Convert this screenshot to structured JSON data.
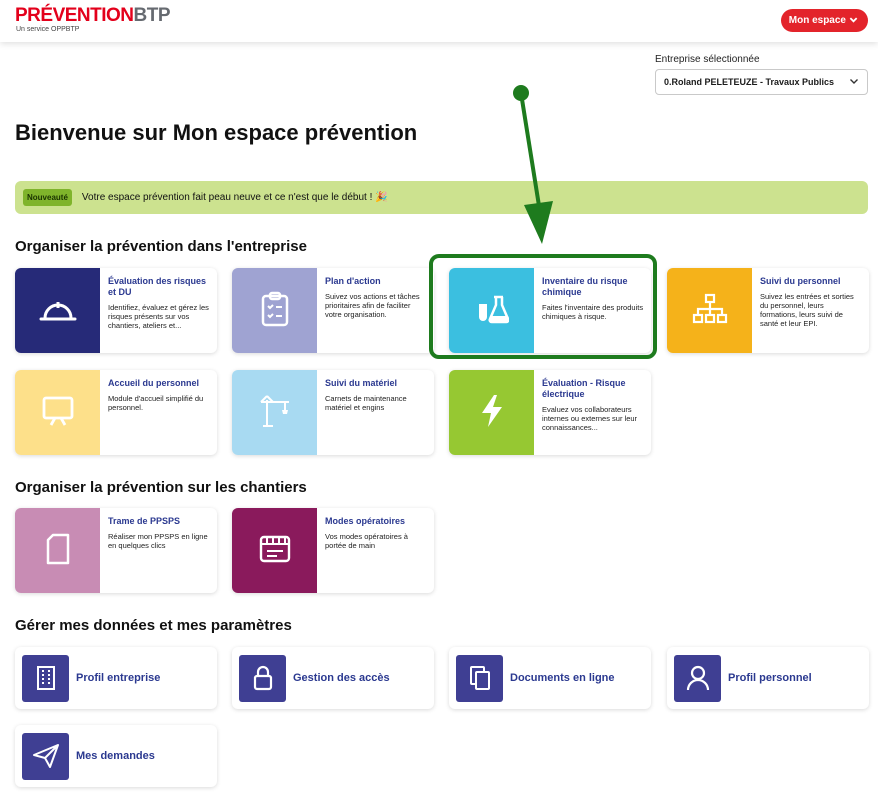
{
  "header": {
    "logo_red": "PRÉVENTION",
    "logo_gray": "BTP",
    "logo_sub": "Un service OPPBTP",
    "mon_espace": "Mon espace",
    "chevron": "⌄"
  },
  "entreprise": {
    "label": "Entreprise sélectionnée",
    "value": "0.Roland PELETEUZE - Travaux Publics"
  },
  "page_title": "Bienvenue sur Mon espace prévention",
  "banner": {
    "badge": "Nouveauté",
    "text": "Votre espace prévention fait peau neuve et ce n'est que le début ! 🎉"
  },
  "sections": {
    "entreprise_title": "Organiser la prévention dans l'entreprise",
    "chantiers_title": "Organiser la prévention sur les chantiers",
    "parametres_title": "Gérer mes données et mes paramètres"
  },
  "cards": {
    "evaluation": {
      "title": "Évaluation des risques et DU",
      "desc": "Identifiez, évaluez et gérez les risques présents sur vos chantiers, ateliers et...",
      "color": "#262a78",
      "icon": "helmet-icon"
    },
    "plan": {
      "title": "Plan d'action",
      "desc": "Suivez vos actions et tâches prioritaires afin de faciliter votre organisation.",
      "color": "#9fa3d2",
      "icon": "clipboard-icon"
    },
    "inventaire": {
      "title": "Inventaire du risque chimique",
      "desc": "Faites l'inventaire des produits chimiques à risque.",
      "color": "#3bbfe0",
      "icon": "flask-icon"
    },
    "suivi_personnel": {
      "title": "Suivi du personnel",
      "desc": "Suivez les entrées et sorties du personnel, leurs formations, leurs suivi de santé et leur EPI.",
      "color": "#f5b21a",
      "icon": "org-chart-icon"
    },
    "accueil": {
      "title": "Accueil du personnel",
      "desc": "Module d'accueil simplifié du personnel.",
      "color": "#fde08a",
      "icon": "presentation-icon"
    },
    "materiel": {
      "title": "Suivi du matériel",
      "desc": "Carnets de maintenance matériel et engins",
      "color": "#a8daf2",
      "icon": "crane-icon"
    },
    "electrique": {
      "title": "Évaluation - Risque électrique",
      "desc": "Evaluez vos collaborateurs internes ou externes sur leur connaissances...",
      "color": "#96c832",
      "icon": "lightning-icon"
    },
    "ppsps": {
      "title": "Trame de PPSPS",
      "desc": "Réaliser mon PPSPS en ligne en quelques clics",
      "color": "#c88cb4",
      "icon": "document-icon"
    },
    "modes": {
      "title": "Modes opératoires",
      "desc": "Vos modes opératoires à portée de main",
      "color": "#8a1a5c",
      "icon": "scroll-icon"
    }
  },
  "settings": {
    "profil_entreprise": "Profil entreprise",
    "gestion_acces": "Gestion des accès",
    "documents": "Documents en ligne",
    "profil_personnel": "Profil personnel",
    "demandes": "Mes demandes"
  },
  "colors": {
    "accent_red": "#e3242b",
    "brand_blue": "#2b3990",
    "icon_bg": "#3f3f93",
    "annotation_green": "#1e7b1e"
  }
}
